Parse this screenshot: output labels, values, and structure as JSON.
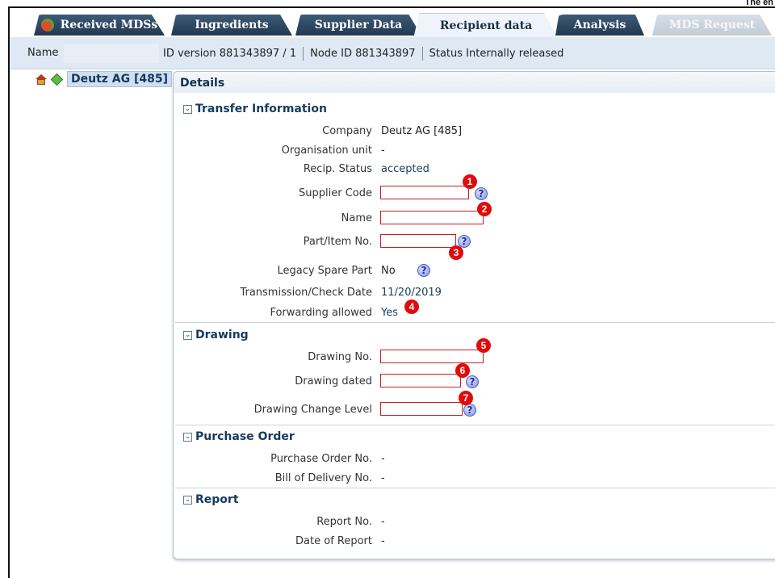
{
  "corner_text": "The en",
  "tabs": [
    {
      "label": "Received MDSs",
      "state": "normal"
    },
    {
      "label": "Ingredients",
      "state": "normal"
    },
    {
      "label": "Supplier Data",
      "state": "normal"
    },
    {
      "label": "Recipient data",
      "state": "active"
    },
    {
      "label": "Analysis",
      "state": "normal"
    },
    {
      "label": "MDS Request",
      "state": "disabled"
    }
  ],
  "infobar": {
    "name_label": "Name",
    "id_version_label": "ID version",
    "id_version_value": "881343897 / 1",
    "node_id_label": "Node ID",
    "node_id_value": "881343897",
    "status_label": "Status",
    "status_value": "Internally released"
  },
  "tree": {
    "node_label": "Deutz AG [485]"
  },
  "details": {
    "title": "Details",
    "transfer": {
      "heading": "Transfer Information",
      "company_label": "Company",
      "company_value": "Deutz AG [485]",
      "org_unit_label": "Organisation unit",
      "org_unit_value": "-",
      "recip_status_label": "Recip. Status",
      "recip_status_value": "accepted",
      "supplier_code_label": "Supplier Code",
      "name_label": "Name",
      "part_no_label": "Part/Item No.",
      "legacy_label": "Legacy Spare Part",
      "legacy_value": "No",
      "transmission_label": "Transmission/Check Date",
      "transmission_value": "11/20/2019",
      "forwarding_label": "Forwarding allowed",
      "forwarding_value": "Yes"
    },
    "drawing": {
      "heading": "Drawing",
      "drawing_no_label": "Drawing No.",
      "drawing_dated_label": "Drawing dated",
      "change_level_label": "Drawing Change Level"
    },
    "purchase": {
      "heading": "Purchase Order",
      "po_label": "Purchase Order No.",
      "po_value": "-",
      "delivery_label": "Bill of Delivery No.",
      "delivery_value": "-"
    },
    "report": {
      "heading": "Report",
      "report_no_label": "Report No.",
      "report_no_value": "-",
      "date_label": "Date of Report",
      "date_value": "-"
    }
  },
  "help_glyph": "?",
  "toggle_glyph": "⌄",
  "badges": [
    "1",
    "2",
    "3",
    "4",
    "5",
    "6",
    "7"
  ],
  "colors": {
    "required_border": "#c81e1e",
    "badge": "#e00b0b",
    "tab_dark": "#22384f"
  }
}
